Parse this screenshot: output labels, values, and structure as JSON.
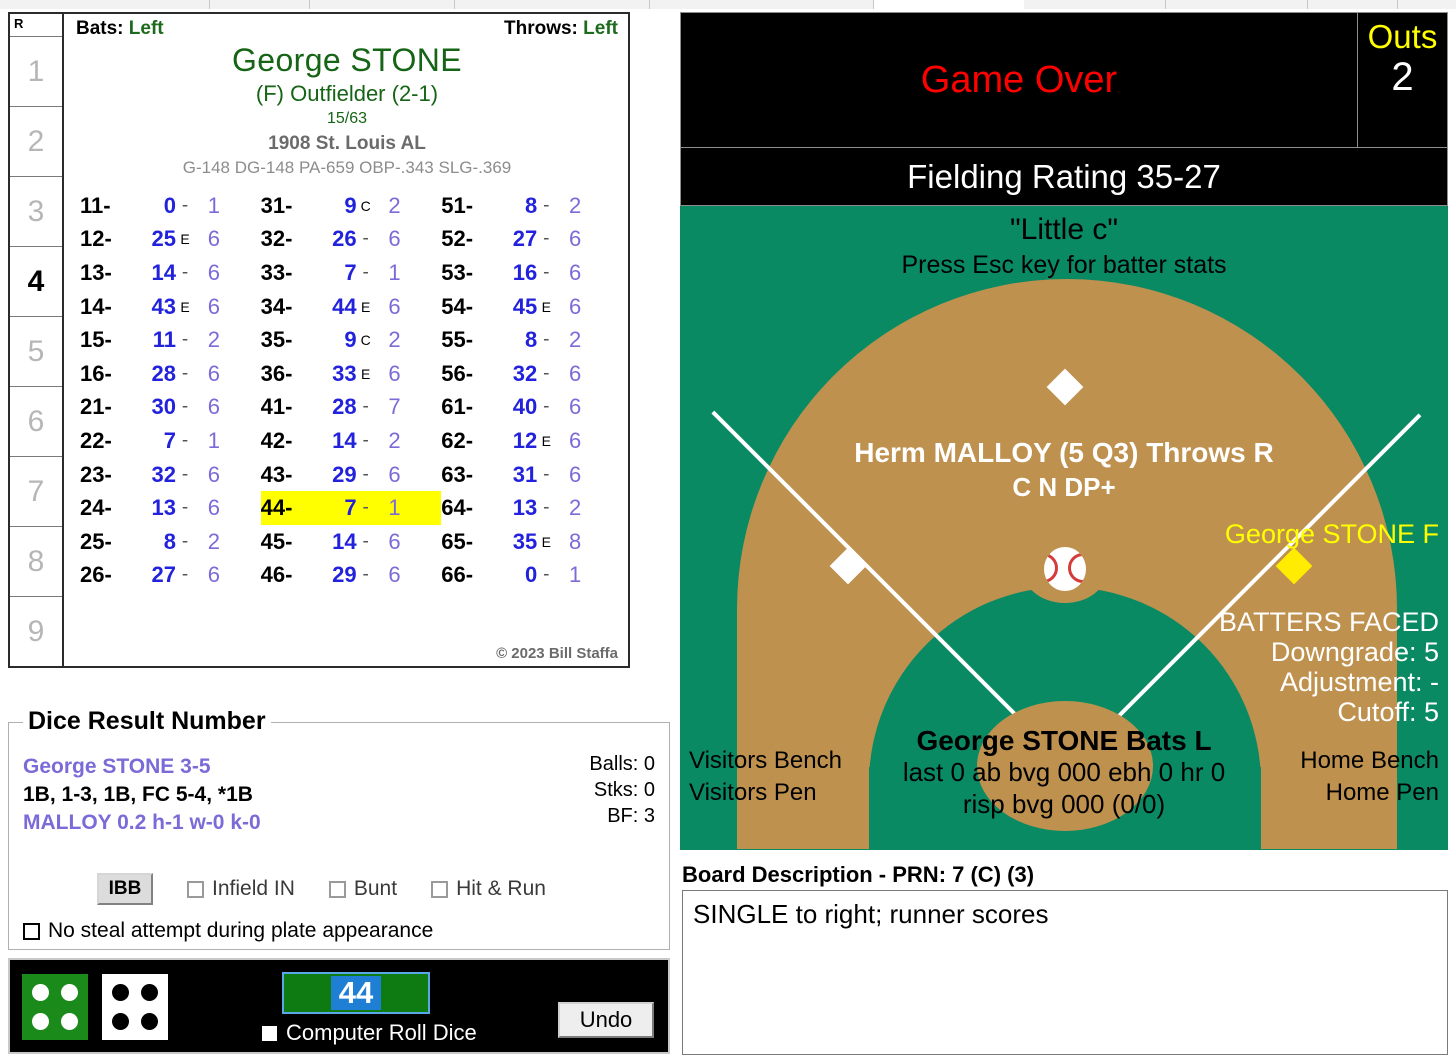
{
  "menubar": {
    "visible": true
  },
  "batter_card": {
    "inning_header": "R",
    "innings": [
      {
        "label": "1",
        "current": false
      },
      {
        "label": "2",
        "current": false
      },
      {
        "label": "3",
        "current": false
      },
      {
        "label": "4",
        "current": true
      },
      {
        "label": "5",
        "current": false
      },
      {
        "label": "6",
        "current": false
      },
      {
        "label": "7",
        "current": false
      },
      {
        "label": "8",
        "current": false
      },
      {
        "label": "9",
        "current": false
      }
    ],
    "bats_label": "Bats:",
    "bats_value": "Left",
    "throws_label": "Throws:",
    "throws_value": "Left",
    "player_name": "George STONE",
    "position": "(F) Outfielder (2-1)",
    "card_number": "15/63",
    "team": "1908 St. Louis AL",
    "stat_line": "G-148 DG-148 PA-659 OBP-.343 SLG-.369",
    "copyright": "© 2023 Bill Staffa",
    "columns": [
      [
        {
          "key": "11-",
          "result": "0",
          "flag": "-",
          "ob": "1",
          "highlight": false
        },
        {
          "key": "12-",
          "result": "25",
          "flag": "E",
          "ob": "6",
          "highlight": false
        },
        {
          "key": "13-",
          "result": "14",
          "flag": "-",
          "ob": "6",
          "highlight": false
        },
        {
          "key": "14-",
          "result": "43",
          "flag": "E",
          "ob": "6",
          "highlight": false
        },
        {
          "key": "15-",
          "result": "11",
          "flag": "-",
          "ob": "2",
          "highlight": false
        },
        {
          "key": "16-",
          "result": "28",
          "flag": "-",
          "ob": "6",
          "highlight": false
        },
        {
          "key": "21-",
          "result": "30",
          "flag": "-",
          "ob": "6",
          "highlight": false
        },
        {
          "key": "22-",
          "result": "7",
          "flag": "-",
          "ob": "1",
          "highlight": false
        },
        {
          "key": "23-",
          "result": "32",
          "flag": "-",
          "ob": "6",
          "highlight": false
        },
        {
          "key": "24-",
          "result": "13",
          "flag": "-",
          "ob": "6",
          "highlight": false
        },
        {
          "key": "25-",
          "result": "8",
          "flag": "-",
          "ob": "2",
          "highlight": false
        },
        {
          "key": "26-",
          "result": "27",
          "flag": "-",
          "ob": "6",
          "highlight": false
        }
      ],
      [
        {
          "key": "31-",
          "result": "9",
          "flag": "C",
          "ob": "2",
          "highlight": false
        },
        {
          "key": "32-",
          "result": "26",
          "flag": "-",
          "ob": "6",
          "highlight": false
        },
        {
          "key": "33-",
          "result": "7",
          "flag": "-",
          "ob": "1",
          "highlight": false
        },
        {
          "key": "34-",
          "result": "44",
          "flag": "E",
          "ob": "6",
          "highlight": false
        },
        {
          "key": "35-",
          "result": "9",
          "flag": "C",
          "ob": "2",
          "highlight": false
        },
        {
          "key": "36-",
          "result": "33",
          "flag": "E",
          "ob": "6",
          "highlight": false
        },
        {
          "key": "41-",
          "result": "28",
          "flag": "-",
          "ob": "7",
          "highlight": false
        },
        {
          "key": "42-",
          "result": "14",
          "flag": "-",
          "ob": "2",
          "highlight": false
        },
        {
          "key": "43-",
          "result": "29",
          "flag": "-",
          "ob": "6",
          "highlight": false
        },
        {
          "key": "44-",
          "result": "7",
          "flag": "-",
          "ob": "1",
          "highlight": true
        },
        {
          "key": "45-",
          "result": "14",
          "flag": "-",
          "ob": "6",
          "highlight": false
        },
        {
          "key": "46-",
          "result": "29",
          "flag": "-",
          "ob": "6",
          "highlight": false
        }
      ],
      [
        {
          "key": "51-",
          "result": "8",
          "flag": "-",
          "ob": "2",
          "highlight": false
        },
        {
          "key": "52-",
          "result": "27",
          "flag": "-",
          "ob": "6",
          "highlight": false
        },
        {
          "key": "53-",
          "result": "16",
          "flag": "-",
          "ob": "6",
          "highlight": false
        },
        {
          "key": "54-",
          "result": "45",
          "flag": "E",
          "ob": "6",
          "highlight": false
        },
        {
          "key": "55-",
          "result": "8",
          "flag": "-",
          "ob": "2",
          "highlight": false
        },
        {
          "key": "56-",
          "result": "32",
          "flag": "-",
          "ob": "6",
          "highlight": false
        },
        {
          "key": "61-",
          "result": "40",
          "flag": "-",
          "ob": "6",
          "highlight": false
        },
        {
          "key": "62-",
          "result": "12",
          "flag": "E",
          "ob": "6",
          "highlight": false
        },
        {
          "key": "63-",
          "result": "31",
          "flag": "-",
          "ob": "6",
          "highlight": false
        },
        {
          "key": "64-",
          "result": "13",
          "flag": "-",
          "ob": "2",
          "highlight": false
        },
        {
          "key": "65-",
          "result": "35",
          "flag": "E",
          "ob": "8",
          "highlight": false
        },
        {
          "key": "66-",
          "result": "0",
          "flag": "-",
          "ob": "1",
          "highlight": false
        }
      ]
    ]
  },
  "dice_result": {
    "legend": "Dice Result Number",
    "batter_line": "George STONE  3-5",
    "result_line": "1B, 1-3, 1B, FC 5-4, *1B",
    "pitcher_line": "MALLOY  0.2  h-1  w-0  k-0",
    "balls": "Balls: 0",
    "strikes": "Stks: 0",
    "bf": "BF: 3",
    "ibb_label": "IBB",
    "infield_in_label": "Infield IN",
    "bunt_label": "Bunt",
    "hit_and_run_label": "Hit & Run",
    "no_steal_label": "No steal attempt during plate appearance",
    "infield_in_checked": false,
    "bunt_checked": false,
    "hit_and_run_checked": false,
    "no_steal_checked": false
  },
  "dice_bar": {
    "die1_value": "4",
    "die2_value": "4",
    "roll_value": "44",
    "computer_roll_label": "Computer Roll Dice",
    "computer_roll_checked": false,
    "undo_label": "Undo"
  },
  "scoreboard": {
    "message": "Game Over",
    "outs_label": "Outs",
    "outs_value": "2",
    "fielding_rating": "Fielding Rating 35-27"
  },
  "field": {
    "title": "\"Little c\"",
    "subtitle": "Press Esc key for batter stats",
    "pitcher_name": "Herm MALLOY (5 Q3) Throws R",
    "pitcher_tags": "C N DP+",
    "fielder_name": "George STONE F",
    "batters_faced_title": "BATTERS FACED",
    "downgrade": "Downgrade: 5",
    "adjustment": "Adjustment: -",
    "cutoff": "Cutoff: 5",
    "batter_name": "George STONE Bats L",
    "batter_line1": "last 0 ab bvg 000 ebh 0 hr 0",
    "batter_line2": "risp bvg 000 (0/0)",
    "visitors_bench": "Visitors Bench",
    "visitors_pen": "Visitors Pen",
    "home_bench": "Home Bench",
    "home_pen": "Home Pen"
  },
  "board_description": {
    "label": "Board Description - PRN: 7 (C) (3)",
    "text": "SINGLE to right; runner scores"
  },
  "colors": {
    "grass": "#0a8a63",
    "dirt": "#bf914f",
    "highlight": "#ffff00",
    "player_green": "#166416",
    "result_blue": "#2222dd",
    "ob_purple": "#7b6bd8",
    "game_over_red": "#ff0000"
  }
}
